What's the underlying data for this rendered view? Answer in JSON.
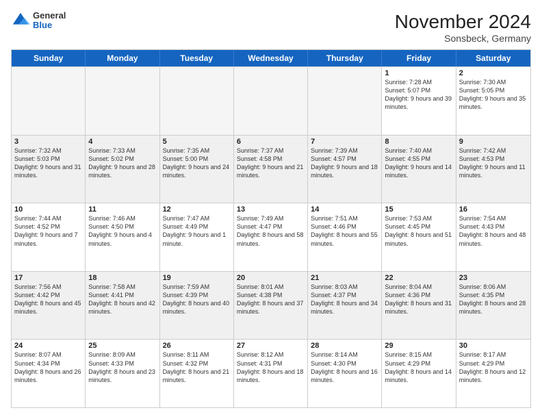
{
  "logo": {
    "general": "General",
    "blue": "Blue"
  },
  "header": {
    "month": "November 2024",
    "location": "Sonsbeck, Germany"
  },
  "days": [
    "Sunday",
    "Monday",
    "Tuesday",
    "Wednesday",
    "Thursday",
    "Friday",
    "Saturday"
  ],
  "rows": [
    [
      {
        "day": "",
        "empty": true
      },
      {
        "day": "",
        "empty": true
      },
      {
        "day": "",
        "empty": true
      },
      {
        "day": "",
        "empty": true
      },
      {
        "day": "",
        "empty": true
      },
      {
        "day": "1",
        "sunrise": "Sunrise: 7:28 AM",
        "sunset": "Sunset: 5:07 PM",
        "daylight": "Daylight: 9 hours and 39 minutes."
      },
      {
        "day": "2",
        "sunrise": "Sunrise: 7:30 AM",
        "sunset": "Sunset: 5:05 PM",
        "daylight": "Daylight: 9 hours and 35 minutes."
      }
    ],
    [
      {
        "day": "3",
        "sunrise": "Sunrise: 7:32 AM",
        "sunset": "Sunset: 5:03 PM",
        "daylight": "Daylight: 9 hours and 31 minutes."
      },
      {
        "day": "4",
        "sunrise": "Sunrise: 7:33 AM",
        "sunset": "Sunset: 5:02 PM",
        "daylight": "Daylight: 9 hours and 28 minutes."
      },
      {
        "day": "5",
        "sunrise": "Sunrise: 7:35 AM",
        "sunset": "Sunset: 5:00 PM",
        "daylight": "Daylight: 9 hours and 24 minutes."
      },
      {
        "day": "6",
        "sunrise": "Sunrise: 7:37 AM",
        "sunset": "Sunset: 4:58 PM",
        "daylight": "Daylight: 9 hours and 21 minutes."
      },
      {
        "day": "7",
        "sunrise": "Sunrise: 7:39 AM",
        "sunset": "Sunset: 4:57 PM",
        "daylight": "Daylight: 9 hours and 18 minutes."
      },
      {
        "day": "8",
        "sunrise": "Sunrise: 7:40 AM",
        "sunset": "Sunset: 4:55 PM",
        "daylight": "Daylight: 9 hours and 14 minutes."
      },
      {
        "day": "9",
        "sunrise": "Sunrise: 7:42 AM",
        "sunset": "Sunset: 4:53 PM",
        "daylight": "Daylight: 9 hours and 11 minutes."
      }
    ],
    [
      {
        "day": "10",
        "sunrise": "Sunrise: 7:44 AM",
        "sunset": "Sunset: 4:52 PM",
        "daylight": "Daylight: 9 hours and 7 minutes."
      },
      {
        "day": "11",
        "sunrise": "Sunrise: 7:46 AM",
        "sunset": "Sunset: 4:50 PM",
        "daylight": "Daylight: 9 hours and 4 minutes."
      },
      {
        "day": "12",
        "sunrise": "Sunrise: 7:47 AM",
        "sunset": "Sunset: 4:49 PM",
        "daylight": "Daylight: 9 hours and 1 minute."
      },
      {
        "day": "13",
        "sunrise": "Sunrise: 7:49 AM",
        "sunset": "Sunset: 4:47 PM",
        "daylight": "Daylight: 8 hours and 58 minutes."
      },
      {
        "day": "14",
        "sunrise": "Sunrise: 7:51 AM",
        "sunset": "Sunset: 4:46 PM",
        "daylight": "Daylight: 8 hours and 55 minutes."
      },
      {
        "day": "15",
        "sunrise": "Sunrise: 7:53 AM",
        "sunset": "Sunset: 4:45 PM",
        "daylight": "Daylight: 8 hours and 51 minutes."
      },
      {
        "day": "16",
        "sunrise": "Sunrise: 7:54 AM",
        "sunset": "Sunset: 4:43 PM",
        "daylight": "Daylight: 8 hours and 48 minutes."
      }
    ],
    [
      {
        "day": "17",
        "sunrise": "Sunrise: 7:56 AM",
        "sunset": "Sunset: 4:42 PM",
        "daylight": "Daylight: 8 hours and 45 minutes."
      },
      {
        "day": "18",
        "sunrise": "Sunrise: 7:58 AM",
        "sunset": "Sunset: 4:41 PM",
        "daylight": "Daylight: 8 hours and 42 minutes."
      },
      {
        "day": "19",
        "sunrise": "Sunrise: 7:59 AM",
        "sunset": "Sunset: 4:39 PM",
        "daylight": "Daylight: 8 hours and 40 minutes."
      },
      {
        "day": "20",
        "sunrise": "Sunrise: 8:01 AM",
        "sunset": "Sunset: 4:38 PM",
        "daylight": "Daylight: 8 hours and 37 minutes."
      },
      {
        "day": "21",
        "sunrise": "Sunrise: 8:03 AM",
        "sunset": "Sunset: 4:37 PM",
        "daylight": "Daylight: 8 hours and 34 minutes."
      },
      {
        "day": "22",
        "sunrise": "Sunrise: 8:04 AM",
        "sunset": "Sunset: 4:36 PM",
        "daylight": "Daylight: 8 hours and 31 minutes."
      },
      {
        "day": "23",
        "sunrise": "Sunrise: 8:06 AM",
        "sunset": "Sunset: 4:35 PM",
        "daylight": "Daylight: 8 hours and 28 minutes."
      }
    ],
    [
      {
        "day": "24",
        "sunrise": "Sunrise: 8:07 AM",
        "sunset": "Sunset: 4:34 PM",
        "daylight": "Daylight: 8 hours and 26 minutes."
      },
      {
        "day": "25",
        "sunrise": "Sunrise: 8:09 AM",
        "sunset": "Sunset: 4:33 PM",
        "daylight": "Daylight: 8 hours and 23 minutes."
      },
      {
        "day": "26",
        "sunrise": "Sunrise: 8:11 AM",
        "sunset": "Sunset: 4:32 PM",
        "daylight": "Daylight: 8 hours and 21 minutes."
      },
      {
        "day": "27",
        "sunrise": "Sunrise: 8:12 AM",
        "sunset": "Sunset: 4:31 PM",
        "daylight": "Daylight: 8 hours and 18 minutes."
      },
      {
        "day": "28",
        "sunrise": "Sunrise: 8:14 AM",
        "sunset": "Sunset: 4:30 PM",
        "daylight": "Daylight: 8 hours and 16 minutes."
      },
      {
        "day": "29",
        "sunrise": "Sunrise: 8:15 AM",
        "sunset": "Sunset: 4:29 PM",
        "daylight": "Daylight: 8 hours and 14 minutes."
      },
      {
        "day": "30",
        "sunrise": "Sunrise: 8:17 AM",
        "sunset": "Sunset: 4:29 PM",
        "daylight": "Daylight: 8 hours and 12 minutes."
      }
    ]
  ]
}
